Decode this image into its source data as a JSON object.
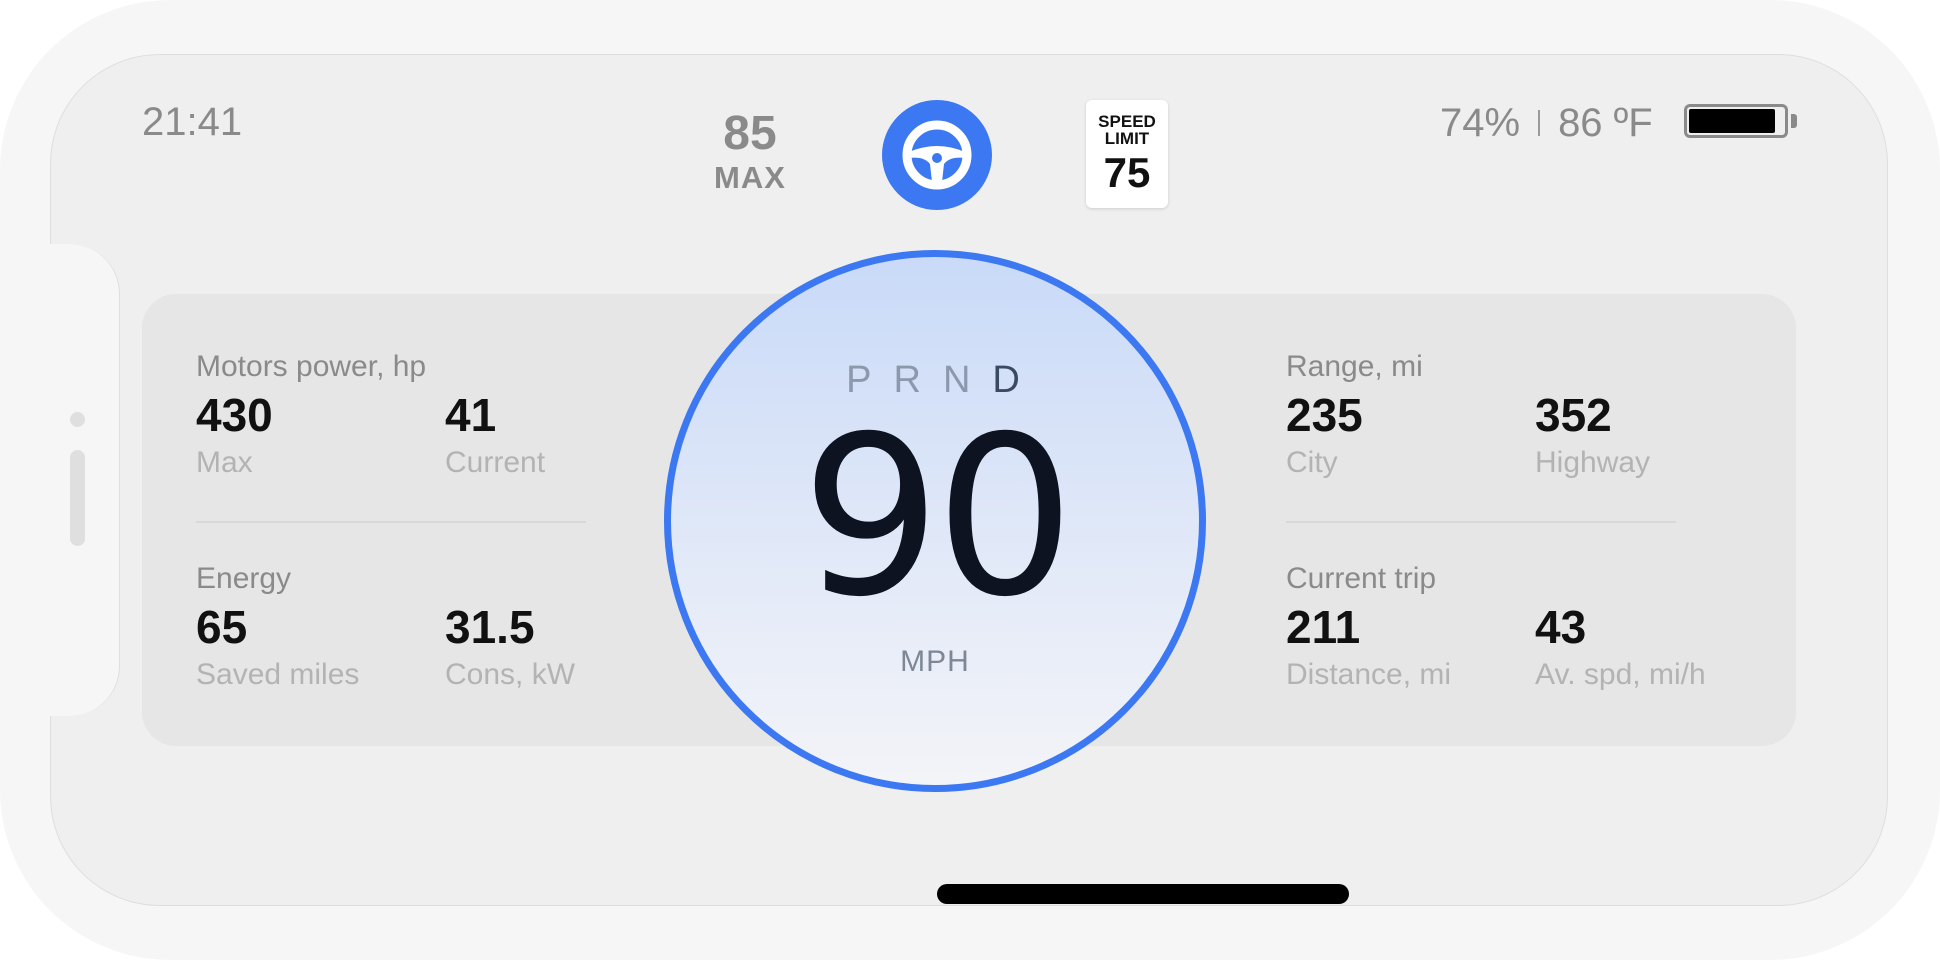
{
  "status_bar": {
    "time": "21:41",
    "battery_percent": "74%",
    "temperature": "86 ºF",
    "battery_level": 0.92
  },
  "cruise": {
    "value": "85",
    "label": "MAX"
  },
  "steering_button": {
    "icon": "steering-wheel-icon",
    "color": "#3b78f2"
  },
  "speed_limit_sign": {
    "title_line1": "SPEED",
    "title_line2": "LIMIT",
    "value": "75"
  },
  "speedometer": {
    "gears": [
      "P",
      "R",
      "N",
      "D"
    ],
    "active_gear": "D",
    "speed": "90",
    "unit": "MPH",
    "accent": "#3b78f2"
  },
  "left_panel": {
    "motors": {
      "title": "Motors power, hp",
      "metrics": [
        {
          "value": "430",
          "label": "Max"
        },
        {
          "value": "41",
          "label": "Current"
        }
      ]
    },
    "energy": {
      "title": "Energy",
      "metrics": [
        {
          "value": "65",
          "label": "Saved miles"
        },
        {
          "value": "31.5",
          "label": "Cons, kW"
        }
      ]
    }
  },
  "right_panel": {
    "range": {
      "title": "Range, mi",
      "metrics": [
        {
          "value": "235",
          "label": "City"
        },
        {
          "value": "352",
          "label": "Highway"
        }
      ]
    },
    "trip": {
      "title": "Current trip",
      "metrics": [
        {
          "value": "211",
          "label": "Distance, mi"
        },
        {
          "value": "43",
          "label": "Av. spd, mi/h"
        }
      ]
    }
  }
}
